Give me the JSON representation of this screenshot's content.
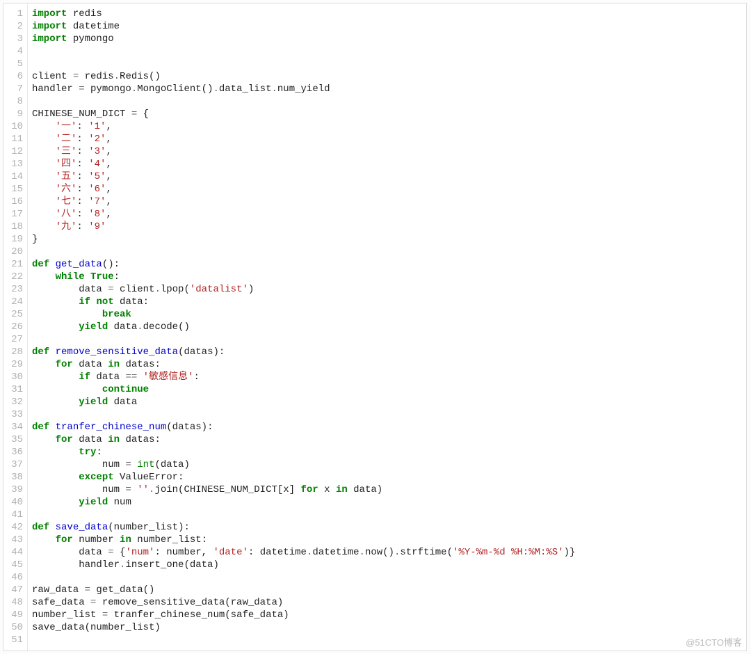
{
  "watermark": "@51CTO博客",
  "lines": [
    {
      "n": 1,
      "t": [
        [
          "kw",
          "import"
        ],
        [
          "pl",
          " redis"
        ]
      ]
    },
    {
      "n": 2,
      "t": [
        [
          "kw",
          "import"
        ],
        [
          "pl",
          " datetime"
        ]
      ]
    },
    {
      "n": 3,
      "t": [
        [
          "kw",
          "import"
        ],
        [
          "pl",
          " pymongo"
        ]
      ]
    },
    {
      "n": 4,
      "t": [
        [
          "pl",
          ""
        ]
      ]
    },
    {
      "n": 5,
      "t": [
        [
          "pl",
          ""
        ]
      ]
    },
    {
      "n": 6,
      "t": [
        [
          "pl",
          "client "
        ],
        [
          "op",
          "="
        ],
        [
          "pl",
          " redis"
        ],
        [
          "op",
          "."
        ],
        [
          "pl",
          "Redis()"
        ]
      ]
    },
    {
      "n": 7,
      "t": [
        [
          "pl",
          "handler "
        ],
        [
          "op",
          "="
        ],
        [
          "pl",
          " pymongo"
        ],
        [
          "op",
          "."
        ],
        [
          "pl",
          "MongoClient()"
        ],
        [
          "op",
          "."
        ],
        [
          "pl",
          "data_list"
        ],
        [
          "op",
          "."
        ],
        [
          "pl",
          "num_yield"
        ]
      ]
    },
    {
      "n": 8,
      "t": [
        [
          "pl",
          ""
        ]
      ]
    },
    {
      "n": 9,
      "t": [
        [
          "pl",
          "CHINESE_NUM_DICT "
        ],
        [
          "op",
          "="
        ],
        [
          "pl",
          " {"
        ]
      ]
    },
    {
      "n": 10,
      "t": [
        [
          "pl",
          "    "
        ],
        [
          "str",
          "'一'"
        ],
        [
          "pl",
          ": "
        ],
        [
          "str",
          "'1'"
        ],
        [
          "pl",
          ","
        ]
      ]
    },
    {
      "n": 11,
      "t": [
        [
          "pl",
          "    "
        ],
        [
          "str",
          "'二'"
        ],
        [
          "pl",
          ": "
        ],
        [
          "str",
          "'2'"
        ],
        [
          "pl",
          ","
        ]
      ]
    },
    {
      "n": 12,
      "t": [
        [
          "pl",
          "    "
        ],
        [
          "str",
          "'三'"
        ],
        [
          "pl",
          ": "
        ],
        [
          "str",
          "'3'"
        ],
        [
          "pl",
          ","
        ]
      ]
    },
    {
      "n": 13,
      "t": [
        [
          "pl",
          "    "
        ],
        [
          "str",
          "'四'"
        ],
        [
          "pl",
          ": "
        ],
        [
          "str",
          "'4'"
        ],
        [
          "pl",
          ","
        ]
      ]
    },
    {
      "n": 14,
      "t": [
        [
          "pl",
          "    "
        ],
        [
          "str",
          "'五'"
        ],
        [
          "pl",
          ": "
        ],
        [
          "str",
          "'5'"
        ],
        [
          "pl",
          ","
        ]
      ]
    },
    {
      "n": 15,
      "t": [
        [
          "pl",
          "    "
        ],
        [
          "str",
          "'六'"
        ],
        [
          "pl",
          ": "
        ],
        [
          "str",
          "'6'"
        ],
        [
          "pl",
          ","
        ]
      ]
    },
    {
      "n": 16,
      "t": [
        [
          "pl",
          "    "
        ],
        [
          "str",
          "'七'"
        ],
        [
          "pl",
          ": "
        ],
        [
          "str",
          "'7'"
        ],
        [
          "pl",
          ","
        ]
      ]
    },
    {
      "n": 17,
      "t": [
        [
          "pl",
          "    "
        ],
        [
          "str",
          "'八'"
        ],
        [
          "pl",
          ": "
        ],
        [
          "str",
          "'8'"
        ],
        [
          "pl",
          ","
        ]
      ]
    },
    {
      "n": 18,
      "t": [
        [
          "pl",
          "    "
        ],
        [
          "str",
          "'九'"
        ],
        [
          "pl",
          ": "
        ],
        [
          "str",
          "'9'"
        ]
      ]
    },
    {
      "n": 19,
      "t": [
        [
          "pl",
          "}"
        ]
      ]
    },
    {
      "n": 20,
      "t": [
        [
          "pl",
          ""
        ]
      ]
    },
    {
      "n": 21,
      "t": [
        [
          "kw",
          "def"
        ],
        [
          "pl",
          " "
        ],
        [
          "fn",
          "get_data"
        ],
        [
          "pl",
          "():"
        ]
      ]
    },
    {
      "n": 22,
      "t": [
        [
          "pl",
          "    "
        ],
        [
          "kw",
          "while"
        ],
        [
          "pl",
          " "
        ],
        [
          "kw",
          "True"
        ],
        [
          "pl",
          ":"
        ]
      ]
    },
    {
      "n": 23,
      "t": [
        [
          "pl",
          "        data "
        ],
        [
          "op",
          "="
        ],
        [
          "pl",
          " client"
        ],
        [
          "op",
          "."
        ],
        [
          "pl",
          "lpop("
        ],
        [
          "str",
          "'datalist'"
        ],
        [
          "pl",
          ")"
        ]
      ]
    },
    {
      "n": 24,
      "t": [
        [
          "pl",
          "        "
        ],
        [
          "kw",
          "if"
        ],
        [
          "pl",
          " "
        ],
        [
          "kw",
          "not"
        ],
        [
          "pl",
          " data:"
        ]
      ]
    },
    {
      "n": 25,
      "t": [
        [
          "pl",
          "            "
        ],
        [
          "kw",
          "break"
        ]
      ]
    },
    {
      "n": 26,
      "t": [
        [
          "pl",
          "        "
        ],
        [
          "kw",
          "yield"
        ],
        [
          "pl",
          " data"
        ],
        [
          "op",
          "."
        ],
        [
          "pl",
          "decode()"
        ]
      ]
    },
    {
      "n": 27,
      "t": [
        [
          "pl",
          ""
        ]
      ]
    },
    {
      "n": 28,
      "t": [
        [
          "kw",
          "def"
        ],
        [
          "pl",
          " "
        ],
        [
          "fn",
          "remove_sensitive_data"
        ],
        [
          "pl",
          "(datas):"
        ]
      ]
    },
    {
      "n": 29,
      "t": [
        [
          "pl",
          "    "
        ],
        [
          "kw",
          "for"
        ],
        [
          "pl",
          " data "
        ],
        [
          "kw",
          "in"
        ],
        [
          "pl",
          " datas:"
        ]
      ]
    },
    {
      "n": 30,
      "t": [
        [
          "pl",
          "        "
        ],
        [
          "kw",
          "if"
        ],
        [
          "pl",
          " data "
        ],
        [
          "op",
          "=="
        ],
        [
          "pl",
          " "
        ],
        [
          "str",
          "'敏感信息'"
        ],
        [
          "pl",
          ":"
        ]
      ]
    },
    {
      "n": 31,
      "t": [
        [
          "pl",
          "            "
        ],
        [
          "kw",
          "continue"
        ]
      ]
    },
    {
      "n": 32,
      "t": [
        [
          "pl",
          "        "
        ],
        [
          "kw",
          "yield"
        ],
        [
          "pl",
          " data"
        ]
      ]
    },
    {
      "n": 33,
      "t": [
        [
          "pl",
          ""
        ]
      ]
    },
    {
      "n": 34,
      "t": [
        [
          "kw",
          "def"
        ],
        [
          "pl",
          " "
        ],
        [
          "fn",
          "tranfer_chinese_num"
        ],
        [
          "pl",
          "(datas):"
        ]
      ]
    },
    {
      "n": 35,
      "t": [
        [
          "pl",
          "    "
        ],
        [
          "kw",
          "for"
        ],
        [
          "pl",
          " data "
        ],
        [
          "kw",
          "in"
        ],
        [
          "pl",
          " datas:"
        ]
      ]
    },
    {
      "n": 36,
      "t": [
        [
          "pl",
          "        "
        ],
        [
          "kw",
          "try"
        ],
        [
          "pl",
          ":"
        ]
      ]
    },
    {
      "n": 37,
      "t": [
        [
          "pl",
          "            num "
        ],
        [
          "op",
          "="
        ],
        [
          "pl",
          " "
        ],
        [
          "bltn",
          "int"
        ],
        [
          "pl",
          "(data)"
        ]
      ]
    },
    {
      "n": 38,
      "t": [
        [
          "pl",
          "        "
        ],
        [
          "kw",
          "except"
        ],
        [
          "pl",
          " ValueError:"
        ]
      ]
    },
    {
      "n": 39,
      "t": [
        [
          "pl",
          "            num "
        ],
        [
          "op",
          "="
        ],
        [
          "pl",
          " "
        ],
        [
          "str",
          "''"
        ],
        [
          "op",
          "."
        ],
        [
          "pl",
          "join(CHINESE_NUM_DICT[x] "
        ],
        [
          "kw",
          "for"
        ],
        [
          "pl",
          " x "
        ],
        [
          "kw",
          "in"
        ],
        [
          "pl",
          " data)"
        ]
      ]
    },
    {
      "n": 40,
      "t": [
        [
          "pl",
          "        "
        ],
        [
          "kw",
          "yield"
        ],
        [
          "pl",
          " num"
        ]
      ]
    },
    {
      "n": 41,
      "t": [
        [
          "pl",
          ""
        ]
      ]
    },
    {
      "n": 42,
      "t": [
        [
          "kw",
          "def"
        ],
        [
          "pl",
          " "
        ],
        [
          "fn",
          "save_data"
        ],
        [
          "pl",
          "(number_list):"
        ]
      ]
    },
    {
      "n": 43,
      "t": [
        [
          "pl",
          "    "
        ],
        [
          "kw",
          "for"
        ],
        [
          "pl",
          " number "
        ],
        [
          "kw",
          "in"
        ],
        [
          "pl",
          " number_list:"
        ]
      ]
    },
    {
      "n": 44,
      "t": [
        [
          "pl",
          "        data "
        ],
        [
          "op",
          "="
        ],
        [
          "pl",
          " {"
        ],
        [
          "str",
          "'num'"
        ],
        [
          "pl",
          ": number, "
        ],
        [
          "str",
          "'date'"
        ],
        [
          "pl",
          ": datetime"
        ],
        [
          "op",
          "."
        ],
        [
          "pl",
          "datetime"
        ],
        [
          "op",
          "."
        ],
        [
          "pl",
          "now()"
        ],
        [
          "op",
          "."
        ],
        [
          "pl",
          "strftime("
        ],
        [
          "str",
          "'%Y-%m-%d %H:%M:%S'"
        ],
        [
          "pl",
          ")}"
        ]
      ]
    },
    {
      "n": 45,
      "t": [
        [
          "pl",
          "        handler"
        ],
        [
          "op",
          "."
        ],
        [
          "pl",
          "insert_one(data)"
        ]
      ]
    },
    {
      "n": 46,
      "t": [
        [
          "pl",
          ""
        ]
      ]
    },
    {
      "n": 47,
      "t": [
        [
          "pl",
          "raw_data "
        ],
        [
          "op",
          "="
        ],
        [
          "pl",
          " get_data()"
        ]
      ]
    },
    {
      "n": 48,
      "t": [
        [
          "pl",
          "safe_data "
        ],
        [
          "op",
          "="
        ],
        [
          "pl",
          " remove_sensitive_data(raw_data)"
        ]
      ]
    },
    {
      "n": 49,
      "t": [
        [
          "pl",
          "number_list "
        ],
        [
          "op",
          "="
        ],
        [
          "pl",
          " tranfer_chinese_num(safe_data)"
        ]
      ]
    },
    {
      "n": 50,
      "t": [
        [
          "pl",
          "save_data(number_list)"
        ]
      ]
    },
    {
      "n": 51,
      "t": [
        [
          "pl",
          ""
        ]
      ]
    }
  ]
}
